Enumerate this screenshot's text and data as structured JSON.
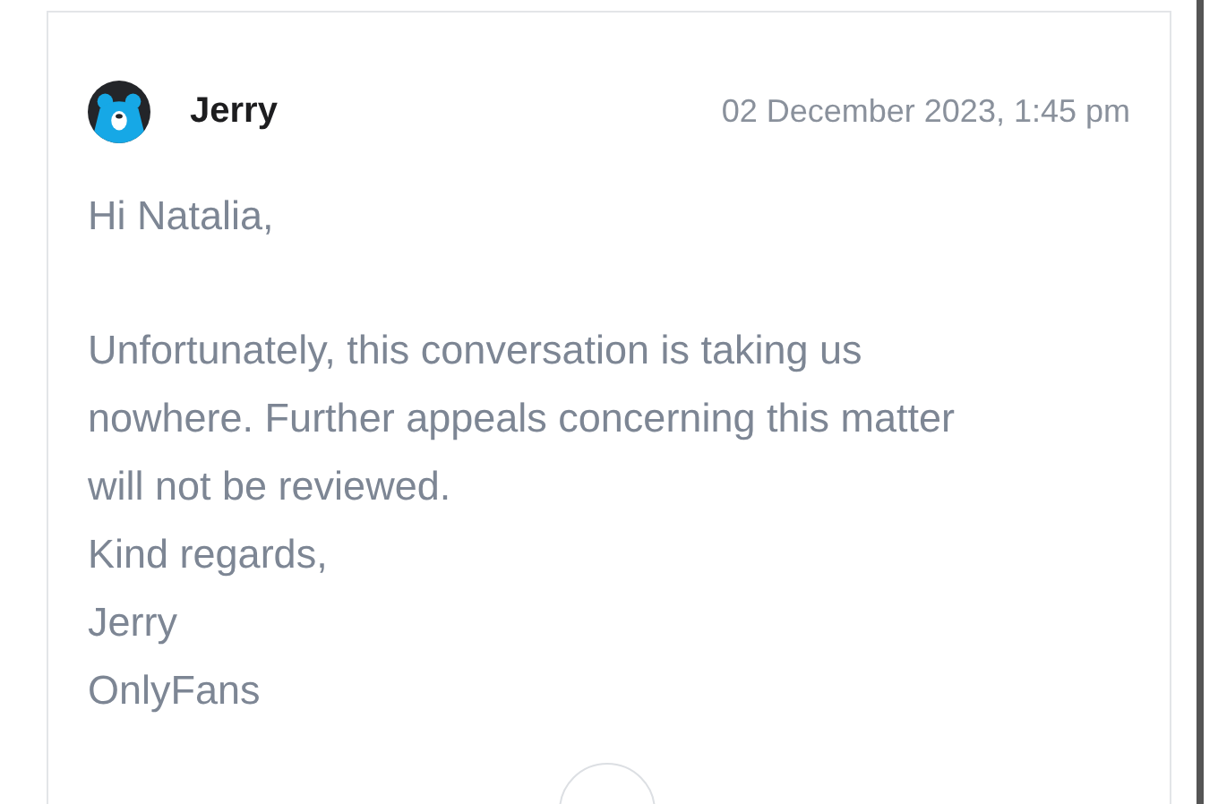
{
  "message": {
    "sender": "Jerry",
    "timestamp": "02 December 2023, 1:45 pm",
    "paragraphs": [
      {
        "lines": [
          "Hi Natalia,"
        ]
      },
      {
        "lines": [
          "Unfortunately, this conversation is taking us",
          "nowhere. Further appeals concerning this matter",
          "will not be reviewed.",
          "Kind regards,",
          "Jerry",
          "OnlyFans"
        ]
      }
    ]
  }
}
